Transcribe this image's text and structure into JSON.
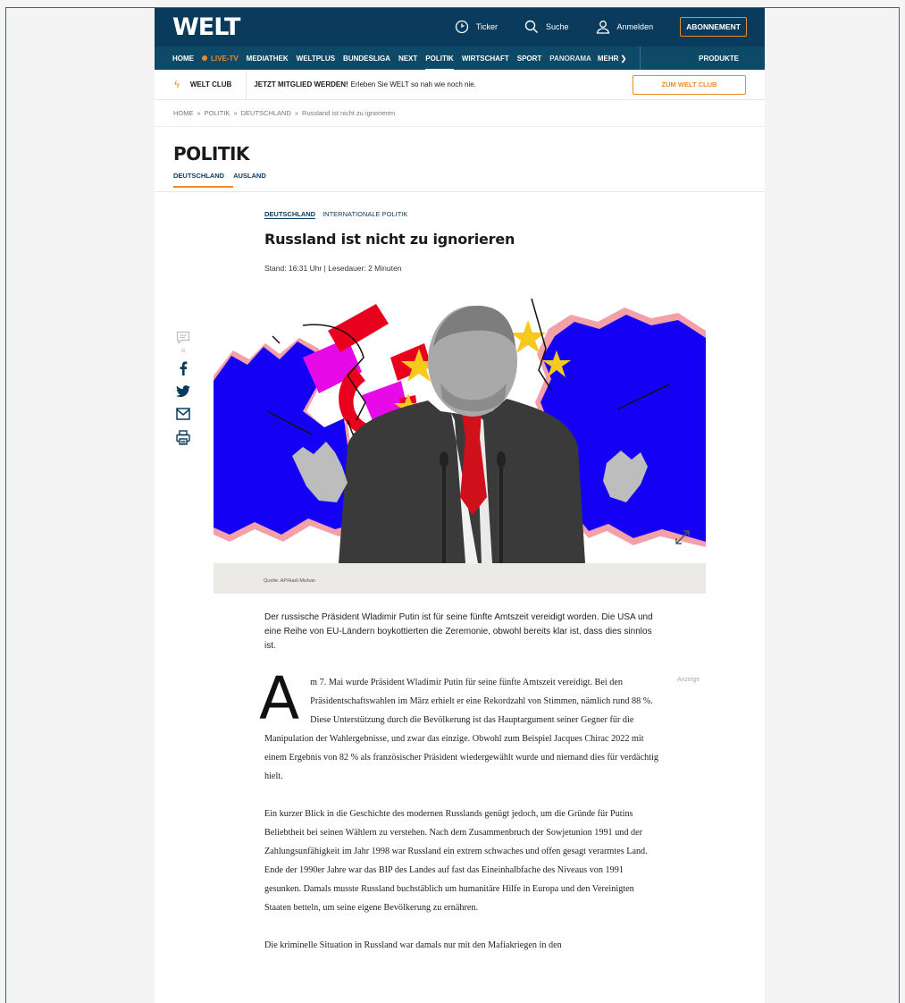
{
  "header": {
    "logo": "WELT",
    "ticker": "Ticker",
    "search": "Suche",
    "login": "Anmelden",
    "subscribe": "ABONNEMENT"
  },
  "nav": {
    "items": [
      "HOME",
      "LIVE-TV",
      "MEDIATHEK",
      "WELTPLUS",
      "BUNDESLIGA",
      "NEXT",
      "POLITIK",
      "WIRTSCHAFT",
      "SPORT",
      "PANORAMA"
    ],
    "more": "MEHR",
    "products": "PRODUKTE"
  },
  "club": {
    "name": "WELT CLUB",
    "cta": "JETZT MITGLIED WERDEN!",
    "text": "Erleben Sie WELT so nah wie noch nie.",
    "button": "ZUM WELT CLUB"
  },
  "breadcrumb": [
    "HOME",
    "»",
    "POLITIK",
    "»",
    "DEUTSCHLAND",
    "»",
    "Russland ist nicht zu ignorieren"
  ],
  "section": {
    "title": "POLITIK",
    "tabs": [
      "DEUTSCHLAND",
      "AUSLAND"
    ]
  },
  "article": {
    "kicker_primary": "DEUTSCHLAND",
    "kicker_secondary": "INTERNATIONALE POLITIK",
    "headline": "Russland ist nicht zu ignorieren",
    "meta": "Stand: 16:31 Uhr | Lesedauer: 2 Minuten",
    "caption": "Quelle: AP/Hadi Mizban",
    "teaser": "Der russische Präsident Wladimir Putin ist für seine fünfte Amtszeit vereidigt worden. Die USA und eine Reihe von EU-Ländern boykottierten die Zeremonie, obwohl bereits klar ist, dass dies sinnlos ist.",
    "ad_label": "Anzeige",
    "dropcap": "A",
    "paragraph1": "m 7. Mai wurde Präsident Wladimir Putin für seine fünfte Amtszeit vereidigt. Bei den Präsidentschaftswahlen im März erhielt er eine Rekordzahl von Stimmen, nämlich rund 88 %. Diese Unterstützung durch die Bevölkerung ist das Hauptargument seiner Gegner für die Manipulation der Wahlergebnisse, und zwar das einzige. Obwohl zum Beispiel Jacques Chirac 2022 mit einem Ergebnis von 82 % als französischer Präsident wiedergewählt wurde und niemand dies für verdächtig hielt.",
    "paragraph2": "Ein kurzer Blick in die Geschichte des modernen Russlands genügt jedoch, um die Gründe für Putins Beliebtheit bei seinen Wählern zu verstehen. Nach dem Zusammenbruch der Sowjetunion 1991 und der Zahlungsunfähigkeit im Jahr 1998 war Russland ein extrem schwaches und offen gesagt verarmtes Land. Ende der 1990er Jahre war das BIP des Landes auf fast das Eineinhalbfache des Niveaus von 1991 gesunken. Damals musste Russland buchstäblich um humanitäre Hilfe in Europa und den Vereinigten Staaten betteln, um seine eigene Bevölkerung zu ernähren.",
    "paragraph3": "Die kriminelle Situation in Russland war damals nur mit den Mafiakriegen in den"
  },
  "colors": {
    "header_bg": "#0b3b5c",
    "nav_bg": "#0f4968",
    "accent": "#f08a24",
    "map_blue": "#1400f5",
    "map_pink": "#f4a0a8",
    "red": "#e8001d",
    "star": "#f7c81e"
  }
}
